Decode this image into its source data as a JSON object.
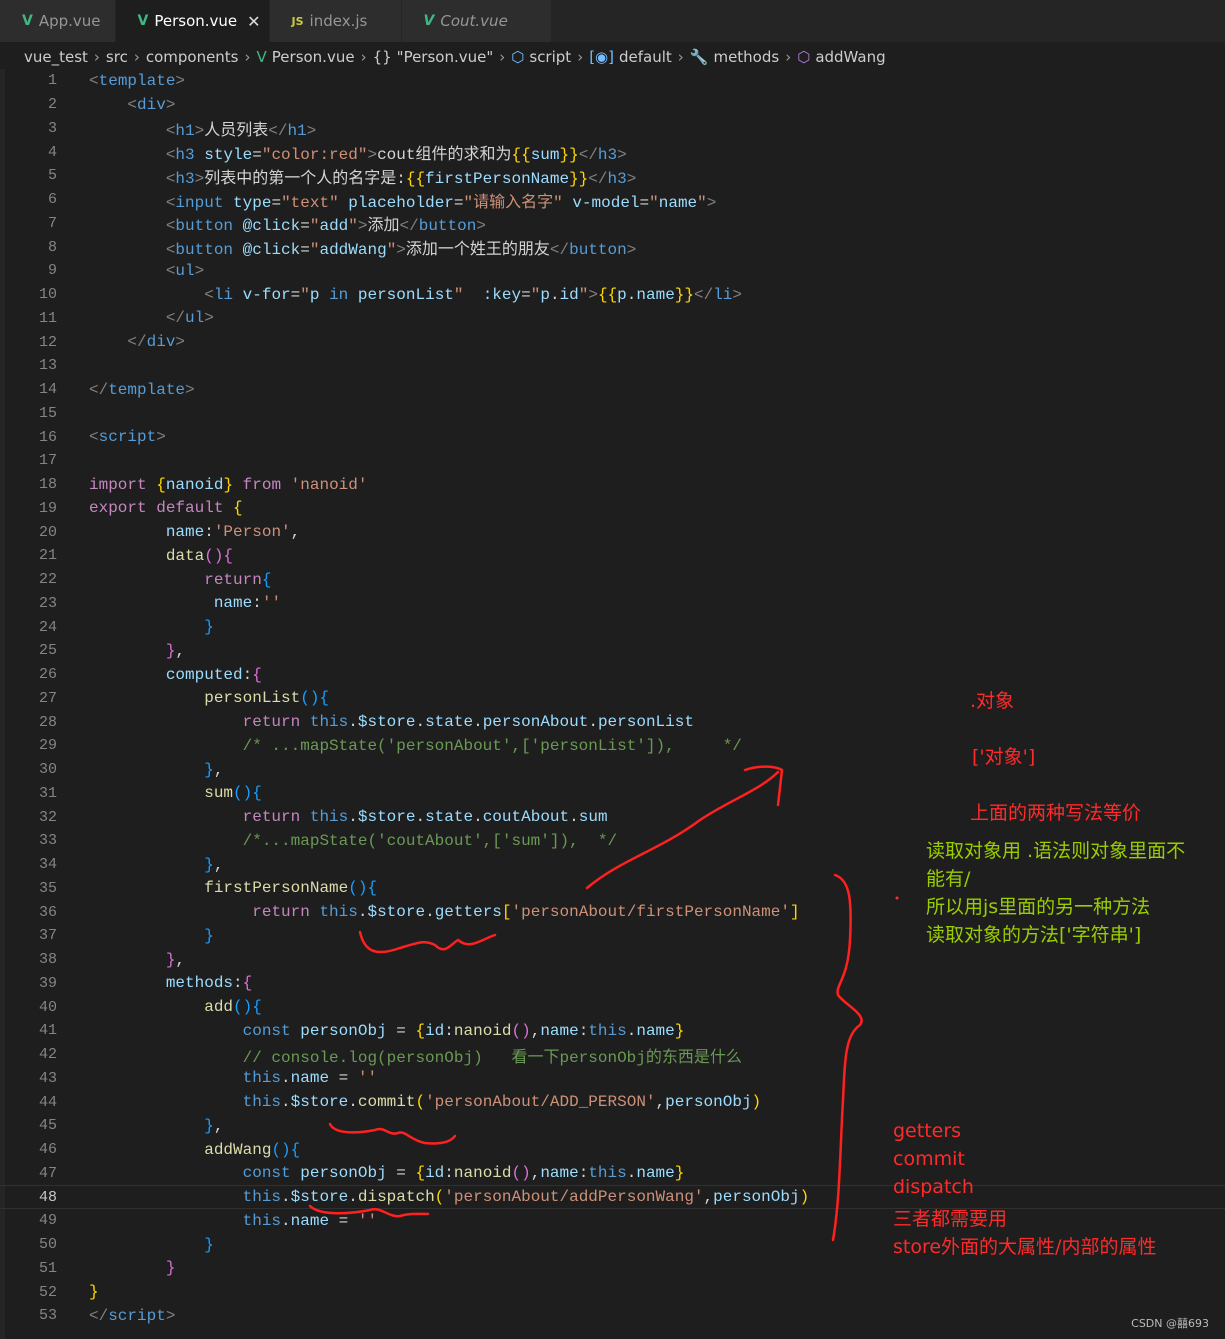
{
  "tabs": [
    {
      "label": "App.vue",
      "icon": "vue-icon",
      "active": false,
      "italic": false
    },
    {
      "label": "Person.vue",
      "icon": "vue-icon",
      "active": true,
      "italic": false
    },
    {
      "label": "index.js",
      "icon": "js-icon",
      "active": false,
      "italic": false
    },
    {
      "label": "Cout.vue",
      "icon": "vue-icon",
      "active": false,
      "italic": true
    }
  ],
  "tab_close": "✕",
  "breadcrumb": [
    {
      "label": "vue_test",
      "icon": ""
    },
    {
      "label": "src",
      "icon": ""
    },
    {
      "label": "components",
      "icon": ""
    },
    {
      "label": "Person.vue",
      "icon": "vue-icon"
    },
    {
      "label": "\"Person.vue\"",
      "icon": "braces-icon"
    },
    {
      "label": "script",
      "icon": "cube-icon"
    },
    {
      "label": "default",
      "icon": "variable-icon"
    },
    {
      "label": "methods",
      "icon": "wrench-icon"
    },
    {
      "label": "addWang",
      "icon": "method-cube-icon"
    }
  ],
  "current_line": 48,
  "code_lines": [
    [
      [
        "p",
        "<"
      ],
      [
        "t",
        "template"
      ],
      [
        "p",
        ">"
      ]
    ],
    [
      [
        "w",
        "    "
      ],
      [
        "p",
        "<"
      ],
      [
        "t",
        "div"
      ],
      [
        "p",
        ">"
      ]
    ],
    [
      [
        "w",
        "        "
      ],
      [
        "p",
        "<"
      ],
      [
        "t",
        "h1"
      ],
      [
        "p",
        ">"
      ],
      [
        "w",
        "人员列表"
      ],
      [
        "p",
        "</"
      ],
      [
        "t",
        "h1"
      ],
      [
        "p",
        ">"
      ]
    ],
    [
      [
        "w",
        "        "
      ],
      [
        "p",
        "<"
      ],
      [
        "t",
        "h3"
      ],
      [
        "a",
        " style"
      ],
      [
        "w",
        "="
      ],
      [
        "s",
        "\"color:red\""
      ],
      [
        "p",
        ">"
      ],
      [
        "w",
        "cout组件的求和为"
      ],
      [
        "b1",
        "{{"
      ],
      [
        "v",
        "sum"
      ],
      [
        "b1",
        "}}"
      ],
      [
        "p",
        "</"
      ],
      [
        "t",
        "h3"
      ],
      [
        "p",
        ">"
      ]
    ],
    [
      [
        "w",
        "        "
      ],
      [
        "p",
        "<"
      ],
      [
        "t",
        "h3"
      ],
      [
        "p",
        ">"
      ],
      [
        "w",
        "列表中的第一个人的名字是:"
      ],
      [
        "b1",
        "{{"
      ],
      [
        "v",
        "firstPersonName"
      ],
      [
        "b1",
        "}}"
      ],
      [
        "p",
        "</"
      ],
      [
        "t",
        "h3"
      ],
      [
        "p",
        ">"
      ]
    ],
    [
      [
        "w",
        "        "
      ],
      [
        "p",
        "<"
      ],
      [
        "t",
        "input"
      ],
      [
        "a",
        " type"
      ],
      [
        "w",
        "="
      ],
      [
        "s",
        "\"text\""
      ],
      [
        "a",
        " placeholder"
      ],
      [
        "w",
        "="
      ],
      [
        "s",
        "\"请输入名字\""
      ],
      [
        "a",
        " v-model"
      ],
      [
        "w",
        "="
      ],
      [
        "s",
        "\""
      ],
      [
        "v",
        "name"
      ],
      [
        "s",
        "\""
      ],
      [
        "p",
        ">"
      ]
    ],
    [
      [
        "w",
        "        "
      ],
      [
        "p",
        "<"
      ],
      [
        "t",
        "button"
      ],
      [
        "a",
        " @click"
      ],
      [
        "w",
        "="
      ],
      [
        "s",
        "\""
      ],
      [
        "v",
        "add"
      ],
      [
        "s",
        "\""
      ],
      [
        "p",
        ">"
      ],
      [
        "w",
        "添加"
      ],
      [
        "p",
        "</"
      ],
      [
        "t",
        "button"
      ],
      [
        "p",
        ">"
      ]
    ],
    [
      [
        "w",
        "        "
      ],
      [
        "p",
        "<"
      ],
      [
        "t",
        "button"
      ],
      [
        "a",
        " @click"
      ],
      [
        "w",
        "="
      ],
      [
        "s",
        "\""
      ],
      [
        "v",
        "addWang"
      ],
      [
        "s",
        "\""
      ],
      [
        "p",
        ">"
      ],
      [
        "w",
        "添加一个姓王的朋友"
      ],
      [
        "p",
        "</"
      ],
      [
        "t",
        "button"
      ],
      [
        "p",
        ">"
      ]
    ],
    [
      [
        "w",
        "        "
      ],
      [
        "p",
        "<"
      ],
      [
        "t",
        "ul"
      ],
      [
        "p",
        ">"
      ]
    ],
    [
      [
        "w",
        "            "
      ],
      [
        "p",
        "<"
      ],
      [
        "t",
        "li"
      ],
      [
        "a",
        " v-for"
      ],
      [
        "w",
        "="
      ],
      [
        "s",
        "\""
      ],
      [
        "v",
        "p"
      ],
      [
        "kb",
        " in "
      ],
      [
        "v",
        "personList"
      ],
      [
        "s",
        "\""
      ],
      [
        "a",
        "  :key"
      ],
      [
        "w",
        "="
      ],
      [
        "s",
        "\""
      ],
      [
        "v",
        "p"
      ],
      [
        "w",
        "."
      ],
      [
        "v",
        "id"
      ],
      [
        "s",
        "\""
      ],
      [
        "p",
        ">"
      ],
      [
        "b1",
        "{{"
      ],
      [
        "v",
        "p"
      ],
      [
        "w",
        "."
      ],
      [
        "v",
        "name"
      ],
      [
        "b1",
        "}}"
      ],
      [
        "p",
        "</"
      ],
      [
        "t",
        "li"
      ],
      [
        "p",
        ">"
      ]
    ],
    [
      [
        "w",
        "        "
      ],
      [
        "p",
        "</"
      ],
      [
        "t",
        "ul"
      ],
      [
        "p",
        ">"
      ]
    ],
    [
      [
        "w",
        "    "
      ],
      [
        "p",
        "</"
      ],
      [
        "t",
        "div"
      ],
      [
        "p",
        ">"
      ]
    ],
    [],
    [
      [
        "p",
        "</"
      ],
      [
        "t",
        "template"
      ],
      [
        "p",
        ">"
      ]
    ],
    [],
    [
      [
        "p",
        "<"
      ],
      [
        "t",
        "script"
      ],
      [
        "p",
        ">"
      ]
    ],
    [],
    [
      [
        "k",
        "import "
      ],
      [
        "b1",
        "{"
      ],
      [
        "v",
        "nanoid"
      ],
      [
        "b1",
        "}"
      ],
      [
        "k",
        " from "
      ],
      [
        "s",
        "'nanoid'"
      ]
    ],
    [
      [
        "k",
        "export default "
      ],
      [
        "b1",
        "{"
      ]
    ],
    [
      [
        "w",
        "        "
      ],
      [
        "v",
        "name"
      ],
      [
        "w",
        ":"
      ],
      [
        "s",
        "'Person'"
      ],
      [
        "w",
        ","
      ]
    ],
    [
      [
        "w",
        "        "
      ],
      [
        "f",
        "data"
      ],
      [
        "b2",
        "()"
      ],
      [
        "b2",
        "{"
      ]
    ],
    [
      [
        "w",
        "            "
      ],
      [
        "k",
        "return"
      ],
      [
        "b3",
        "{"
      ]
    ],
    [
      [
        "w",
        "             "
      ],
      [
        "v",
        "name"
      ],
      [
        "w",
        ":"
      ],
      [
        "s",
        "''"
      ]
    ],
    [
      [
        "w",
        "            "
      ],
      [
        "b3",
        "}"
      ]
    ],
    [
      [
        "w",
        "        "
      ],
      [
        "b2",
        "}"
      ],
      [
        "w",
        ","
      ]
    ],
    [
      [
        "w",
        "        "
      ],
      [
        "v",
        "computed"
      ],
      [
        "w",
        ":"
      ],
      [
        "b2",
        "{"
      ]
    ],
    [
      [
        "w",
        "            "
      ],
      [
        "f",
        "personList"
      ],
      [
        "b3",
        "()"
      ],
      [
        "b3",
        "{"
      ]
    ],
    [
      [
        "w",
        "                "
      ],
      [
        "k",
        "return "
      ],
      [
        "th",
        "this"
      ],
      [
        "w",
        "."
      ],
      [
        "v",
        "$store"
      ],
      [
        "w",
        "."
      ],
      [
        "v",
        "state"
      ],
      [
        "w",
        "."
      ],
      [
        "v",
        "personAbout"
      ],
      [
        "w",
        "."
      ],
      [
        "v",
        "personList"
      ]
    ],
    [
      [
        "w",
        "                "
      ],
      [
        "c",
        "/* ...mapState('personAbout',['personList']),     */"
      ]
    ],
    [
      [
        "w",
        "            "
      ],
      [
        "b3",
        "}"
      ],
      [
        "w",
        ","
      ]
    ],
    [
      [
        "w",
        "            "
      ],
      [
        "f",
        "sum"
      ],
      [
        "b3",
        "()"
      ],
      [
        "b3",
        "{"
      ]
    ],
    [
      [
        "w",
        "                "
      ],
      [
        "k",
        "return "
      ],
      [
        "th",
        "this"
      ],
      [
        "w",
        "."
      ],
      [
        "v",
        "$store"
      ],
      [
        "w",
        "."
      ],
      [
        "v",
        "state"
      ],
      [
        "w",
        "."
      ],
      [
        "v",
        "coutAbout"
      ],
      [
        "w",
        "."
      ],
      [
        "v",
        "sum"
      ]
    ],
    [
      [
        "w",
        "                "
      ],
      [
        "c",
        "/*...mapState('coutAbout',['sum']),  */"
      ]
    ],
    [
      [
        "w",
        "            "
      ],
      [
        "b3",
        "}"
      ],
      [
        "w",
        ","
      ]
    ],
    [
      [
        "w",
        "            "
      ],
      [
        "f",
        "firstPersonName"
      ],
      [
        "b3",
        "()"
      ],
      [
        "b3",
        "{"
      ]
    ],
    [
      [
        "w",
        "                 "
      ],
      [
        "k",
        "return "
      ],
      [
        "th",
        "this"
      ],
      [
        "w",
        "."
      ],
      [
        "v",
        "$store"
      ],
      [
        "w",
        "."
      ],
      [
        "v",
        "getters"
      ],
      [
        "b1",
        "["
      ],
      [
        "s",
        "'personAbout/firstPersonName'"
      ],
      [
        "b1",
        "]"
      ]
    ],
    [
      [
        "w",
        "            "
      ],
      [
        "b3",
        "}"
      ]
    ],
    [
      [
        "w",
        "        "
      ],
      [
        "b2",
        "}"
      ],
      [
        "w",
        ","
      ]
    ],
    [
      [
        "w",
        "        "
      ],
      [
        "v",
        "methods"
      ],
      [
        "w",
        ":"
      ],
      [
        "b2",
        "{"
      ]
    ],
    [
      [
        "w",
        "            "
      ],
      [
        "f",
        "add"
      ],
      [
        "b3",
        "()"
      ],
      [
        "b3",
        "{"
      ]
    ],
    [
      [
        "w",
        "                "
      ],
      [
        "kb",
        "const "
      ],
      [
        "v",
        "personObj"
      ],
      [
        "w",
        " = "
      ],
      [
        "b1",
        "{"
      ],
      [
        "v",
        "id"
      ],
      [
        "w",
        ":"
      ],
      [
        "f",
        "nanoid"
      ],
      [
        "b2",
        "()"
      ],
      [
        "w",
        ","
      ],
      [
        "v",
        "name"
      ],
      [
        "w",
        ":"
      ],
      [
        "th",
        "this"
      ],
      [
        "w",
        "."
      ],
      [
        "v",
        "name"
      ],
      [
        "b1",
        "}"
      ]
    ],
    [
      [
        "w",
        "                "
      ],
      [
        "c",
        "// console.log(personObj)   看一下personObj的东西是什么"
      ]
    ],
    [
      [
        "w",
        "                "
      ],
      [
        "th",
        "this"
      ],
      [
        "w",
        "."
      ],
      [
        "v",
        "name"
      ],
      [
        "w",
        " = "
      ],
      [
        "s",
        "''"
      ]
    ],
    [
      [
        "w",
        "                "
      ],
      [
        "th",
        "this"
      ],
      [
        "w",
        "."
      ],
      [
        "v",
        "$store"
      ],
      [
        "w",
        "."
      ],
      [
        "f",
        "commit"
      ],
      [
        "b1",
        "("
      ],
      [
        "s",
        "'personAbout/ADD_PERSON'"
      ],
      [
        "w",
        ","
      ],
      [
        "v",
        "personObj"
      ],
      [
        "b1",
        ")"
      ]
    ],
    [
      [
        "w",
        "            "
      ],
      [
        "b3",
        "}"
      ],
      [
        "w",
        ","
      ]
    ],
    [
      [
        "w",
        "            "
      ],
      [
        "f",
        "addWang"
      ],
      [
        "b3",
        "()"
      ],
      [
        "b3",
        "{"
      ]
    ],
    [
      [
        "w",
        "                "
      ],
      [
        "kb",
        "const "
      ],
      [
        "v",
        "personObj"
      ],
      [
        "w",
        " = "
      ],
      [
        "b1",
        "{"
      ],
      [
        "v",
        "id"
      ],
      [
        "w",
        ":"
      ],
      [
        "f",
        "nanoid"
      ],
      [
        "b2",
        "()"
      ],
      [
        "w",
        ","
      ],
      [
        "v",
        "name"
      ],
      [
        "w",
        ":"
      ],
      [
        "th",
        "this"
      ],
      [
        "w",
        "."
      ],
      [
        "v",
        "name"
      ],
      [
        "b1",
        "}"
      ]
    ],
    [
      [
        "w",
        "                "
      ],
      [
        "th",
        "this"
      ],
      [
        "w",
        "."
      ],
      [
        "v",
        "$store"
      ],
      [
        "w",
        "."
      ],
      [
        "f",
        "dispatch"
      ],
      [
        "b1",
        "("
      ],
      [
        "s",
        "'personAbout/addPersonWang'"
      ],
      [
        "w",
        ","
      ],
      [
        "v",
        "personObj"
      ],
      [
        "b1",
        ")"
      ]
    ],
    [
      [
        "w",
        "                "
      ],
      [
        "th",
        "this"
      ],
      [
        "w",
        "."
      ],
      [
        "v",
        "name"
      ],
      [
        "w",
        " = "
      ],
      [
        "s",
        "''"
      ]
    ],
    [
      [
        "w",
        "            "
      ],
      [
        "b3",
        "}"
      ]
    ],
    [
      [
        "w",
        "        "
      ],
      [
        "b2",
        "}"
      ]
    ],
    [
      [
        "b1",
        "}"
      ]
    ],
    [
      [
        "p",
        "</"
      ],
      [
        "t",
        "script"
      ],
      [
        "p",
        ">"
      ]
    ]
  ],
  "annotations": {
    "dot_object": ".对象",
    "bracket_object": "['对象']",
    "equivalent": "上面的两种写法等价",
    "green_lines": [
      "读取对象用 .语法则对象里面不",
      "能有/",
      "所以用js里面的另一种方法",
      "读取对象的方法['字符串']"
    ],
    "bottom_lines": [
      "getters",
      "commit",
      "dispatch",
      "三者都需要用",
      "store外面的大属性/内部的属性"
    ]
  },
  "colors": {
    "annotation_red": "#ff2a2a",
    "annotation_green": "#9acd00",
    "vue": "#41b883"
  },
  "watermark": "CSDN @囍693"
}
